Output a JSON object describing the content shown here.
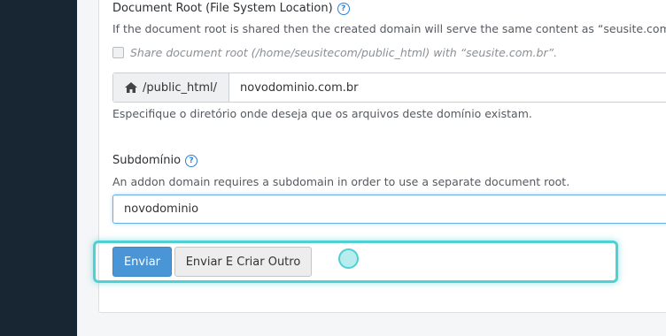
{
  "document_root": {
    "label": "Document Root (File System Location)",
    "help_text": "If the document root is shared then the created domain will serve the same content as “seusite.com.br”.",
    "share_checkbox_label": "Share document root (/home/seusitecom/public_html) with “seusite.com.br”.",
    "share_checked": false,
    "path_prefix": "/public_html/",
    "value": "novodominio.com.br",
    "note": "Especifique o diretório onde deseja que os arquivos deste domínio existam."
  },
  "subdomain": {
    "label": "Subdomínio",
    "help_text": "An addon domain requires a subdomain in order to use a separate document root.",
    "value": "novodominio"
  },
  "actions": {
    "submit_label": "Enviar",
    "submit_and_create_label": "Enviar E Criar Outro"
  },
  "colors": {
    "sidebar": "#182533",
    "primary": "#4a95d6",
    "highlight": "#4fd0d3"
  }
}
